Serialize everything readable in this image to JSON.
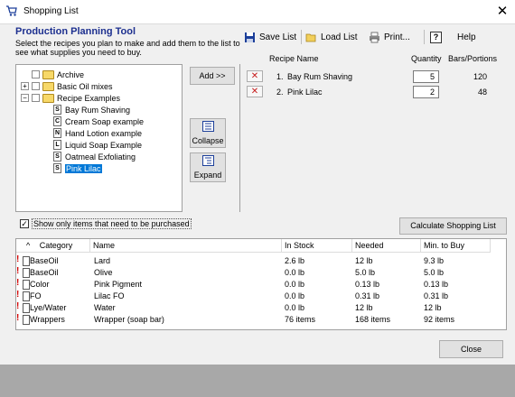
{
  "window": {
    "title": "Shopping List",
    "close_glyph": "✕"
  },
  "header": {
    "title": "Production Planning Tool",
    "subtitle": "Select the recipes you plan to make and add them to the list to see what supplies you need to buy."
  },
  "toolbar": {
    "save": "Save List",
    "load": "Load List",
    "print": "Print...",
    "help_glyph": "?",
    "help": "Help"
  },
  "tree": {
    "items": [
      {
        "label": "Archive",
        "kind": "folder",
        "expander": ""
      },
      {
        "label": "Basic Oil mixes",
        "kind": "folder",
        "expander": "+"
      },
      {
        "label": "Recipe Examples",
        "kind": "folder",
        "expander": "−"
      },
      {
        "label": "Bay Rum Shaving",
        "kind": "doc",
        "type_letter": "S"
      },
      {
        "label": "Cream Soap example",
        "kind": "doc",
        "type_letter": "C"
      },
      {
        "label": "Hand Lotion example",
        "kind": "doc",
        "type_letter": "N"
      },
      {
        "label": "Liquid Soap Example",
        "kind": "doc",
        "type_letter": "L"
      },
      {
        "label": "Oatmeal Exfoliating",
        "kind": "doc",
        "type_letter": "S"
      },
      {
        "label": "Pink Lilac",
        "kind": "doc",
        "type_letter": "S",
        "selected": true
      }
    ]
  },
  "buttons": {
    "add": "Add >>",
    "collapse": "Collapse",
    "expand": "Expand",
    "calculate": "Calculate Shopping List",
    "close": "Close"
  },
  "recipes": {
    "headers": {
      "name": "Recipe Name",
      "qty": "Quantity",
      "bars": "Bars/Portions"
    },
    "remove_glyph": "✕",
    "rows": [
      {
        "num": "1.",
        "name": "Bay Rum Shaving",
        "qty": "5",
        "bars": "120"
      },
      {
        "num": "2.",
        "name": "Pink Lilac",
        "qty": "2",
        "bars": "48"
      }
    ]
  },
  "options": {
    "show_only_label": "Show only items that need to be purchased",
    "show_only_checked": "✓"
  },
  "table": {
    "sort_glyph": "^",
    "columns": [
      "Category",
      "Name",
      "In Stock",
      "Needed",
      "Min. to Buy"
    ],
    "rows": [
      {
        "flag": "!",
        "category": "BaseOil",
        "name": "Lard",
        "in_stock": "2.6 lb",
        "needed": "12 lb",
        "min_buy": "9.3 lb"
      },
      {
        "flag": "!",
        "category": "BaseOil",
        "name": "Olive",
        "in_stock": "0.0 lb",
        "needed": "5.0 lb",
        "min_buy": "5.0 lb"
      },
      {
        "flag": "!",
        "category": "Color",
        "name": "Pink Pigment",
        "in_stock": "0.0 lb",
        "needed": "0.13 lb",
        "min_buy": "0.13 lb"
      },
      {
        "flag": "!",
        "category": "FO",
        "name": "Lilac FO",
        "in_stock": "0.0 lb",
        "needed": "0.31 lb",
        "min_buy": "0.31 lb"
      },
      {
        "flag": "!",
        "category": "Lye/Water",
        "name": "Water",
        "in_stock": "0.0 lb",
        "needed": "12 lb",
        "min_buy": "12 lb"
      },
      {
        "flag": "!",
        "category": "Wrappers",
        "name": "Wrapper (soap bar)",
        "in_stock": "76 items",
        "needed": "168 items",
        "min_buy": "92 items"
      }
    ]
  }
}
